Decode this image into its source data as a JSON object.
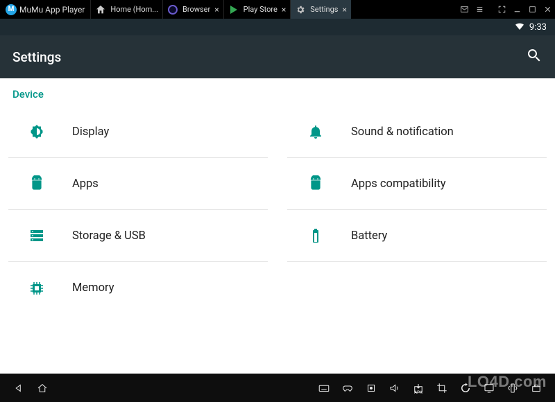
{
  "emulator": {
    "brand": "MuMu App Player",
    "tabs": [
      {
        "label": "Home (Hom...",
        "icon": "home-icon",
        "closable": false
      },
      {
        "label": "Browser",
        "icon": "browser-icon",
        "closable": true
      },
      {
        "label": "Play Store",
        "icon": "play-store-icon",
        "closable": true
      },
      {
        "label": "Settings",
        "icon": "settings-gear-icon",
        "closable": true,
        "active": true
      }
    ],
    "window_controls": [
      "mail",
      "menu",
      "fullscreen",
      "minimize",
      "maximize",
      "close"
    ]
  },
  "status": {
    "time": "9:33"
  },
  "appbar": {
    "title": "Settings"
  },
  "section": {
    "header": "Device",
    "items": [
      {
        "key": "display",
        "label": "Display",
        "icon": "brightness-icon"
      },
      {
        "key": "sound",
        "label": "Sound & notification",
        "icon": "bell-icon"
      },
      {
        "key": "apps",
        "label": "Apps",
        "icon": "android-icon"
      },
      {
        "key": "apps-compat",
        "label": "Apps compatibility",
        "icon": "android-icon"
      },
      {
        "key": "storage",
        "label": "Storage & USB",
        "icon": "storage-icon"
      },
      {
        "key": "battery",
        "label": "Battery",
        "icon": "battery-icon"
      },
      {
        "key": "memory",
        "label": "Memory",
        "icon": "memory-icon"
      }
    ]
  },
  "navbar": {
    "left": [
      "back",
      "home"
    ],
    "right": [
      "keyboard",
      "gamepad",
      "location",
      "volume",
      "apk",
      "crop",
      "rotate",
      "screenshot",
      "shake",
      "more"
    ]
  },
  "watermark": "LO4D.com",
  "colors": {
    "teal": "#009688",
    "appbar": "#263238",
    "status": "#1e2b32"
  }
}
